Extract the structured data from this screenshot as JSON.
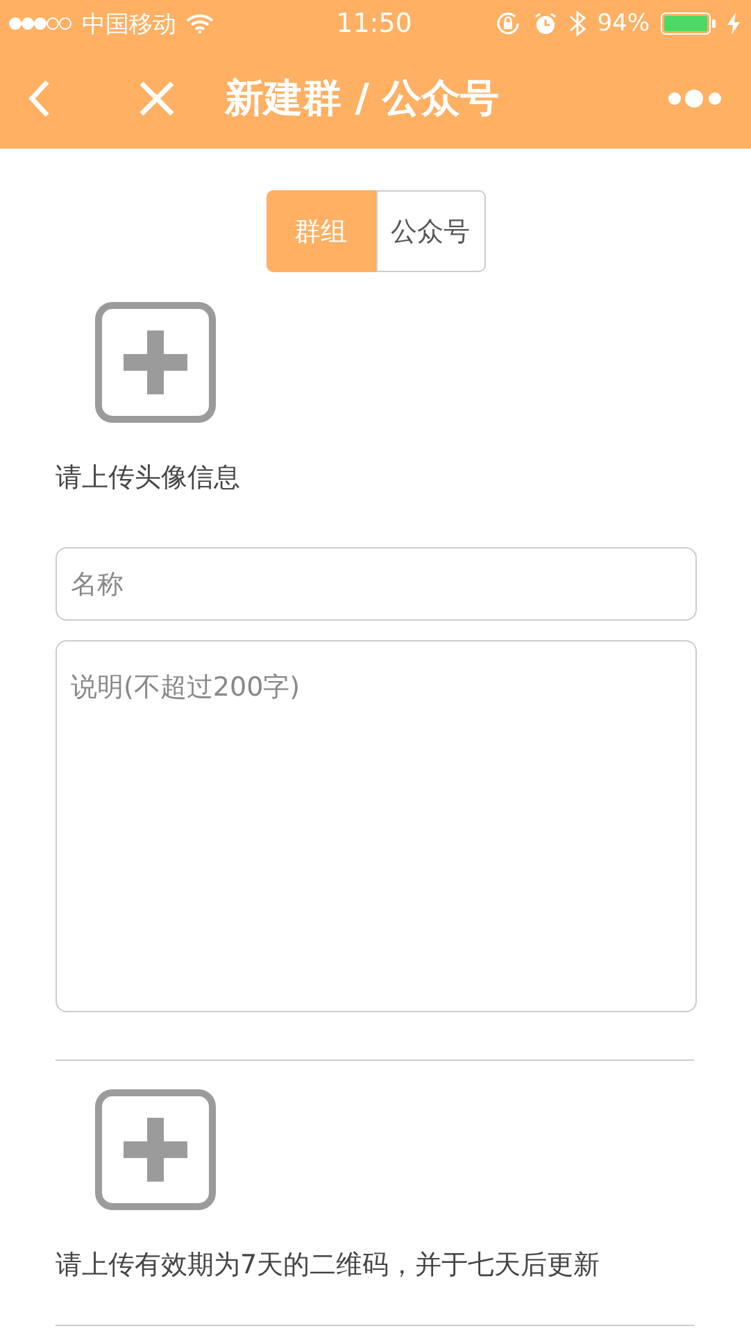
{
  "status_bar": {
    "carrier": "中国移动",
    "time": "11:50",
    "battery": "94%"
  },
  "nav_bar": {
    "title": "新建群 / 公众号"
  },
  "tabs": [
    {
      "label": "群组",
      "selected": true
    },
    {
      "label": "公众号",
      "selected": false
    }
  ],
  "avatar_upload": {
    "caption": "请上传头像信息"
  },
  "name_field": {
    "placeholder": "名称"
  },
  "description_field": {
    "placeholder": "说明(不超过200字)"
  },
  "qr_upload": {
    "caption": "请上传有效期为7天的二维码，并于七天后更新"
  }
}
